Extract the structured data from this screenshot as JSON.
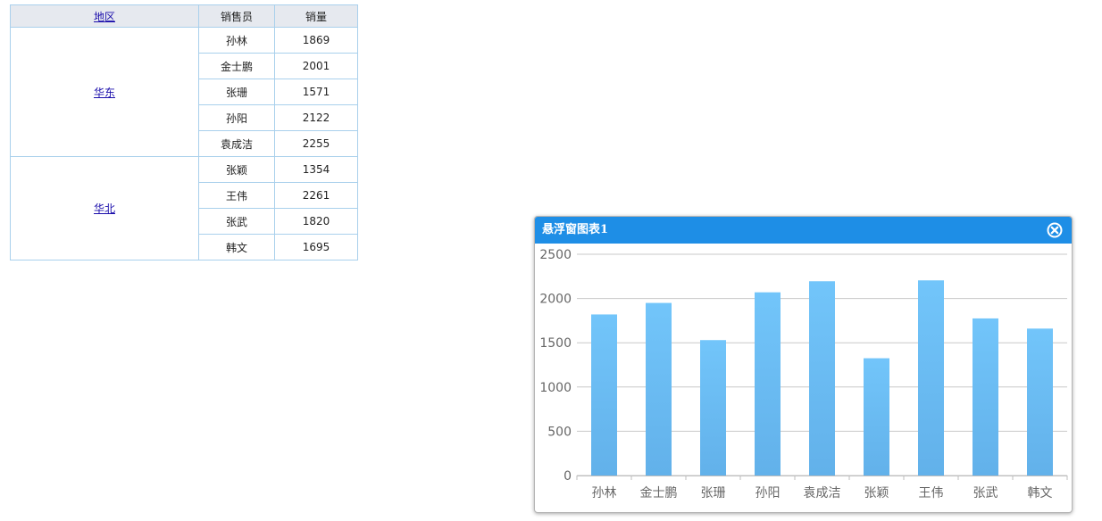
{
  "table": {
    "headers": {
      "region": "地区",
      "salesperson": "销售员",
      "sales": "销量"
    },
    "groups": [
      {
        "region": "华东",
        "rows": [
          {
            "name": "孙林",
            "sales": "1869"
          },
          {
            "name": "金士鹏",
            "sales": "2001"
          },
          {
            "name": "张珊",
            "sales": "1571"
          },
          {
            "name": "孙阳",
            "sales": "2122"
          },
          {
            "name": "袁成洁",
            "sales": "2255"
          }
        ]
      },
      {
        "region": "华北",
        "rows": [
          {
            "name": "张颖",
            "sales": "1354"
          },
          {
            "name": "王伟",
            "sales": "2261"
          },
          {
            "name": "张武",
            "sales": "1820"
          },
          {
            "name": "韩文",
            "sales": "1695"
          }
        ]
      }
    ]
  },
  "float_window": {
    "title": "悬浮窗图表1",
    "close_icon": "close-circle-icon",
    "title_bar_color": "#1e8ee6"
  },
  "chart_data": {
    "type": "bar",
    "title": "",
    "xlabel": "",
    "ylabel": "",
    "categories": [
      "孙林",
      "金士鹏",
      "张珊",
      "孙阳",
      "袁成洁",
      "张颖",
      "王伟",
      "张武",
      "韩文"
    ],
    "values": [
      1820,
      1950,
      1530,
      2070,
      2195,
      1325,
      2205,
      1775,
      1660
    ],
    "ylim": [
      0,
      2500
    ],
    "yticks": [
      "0",
      "500",
      "1000",
      "1500",
      "2000",
      "2500"
    ],
    "grid": true,
    "bar_color": "#6cc0f7"
  }
}
